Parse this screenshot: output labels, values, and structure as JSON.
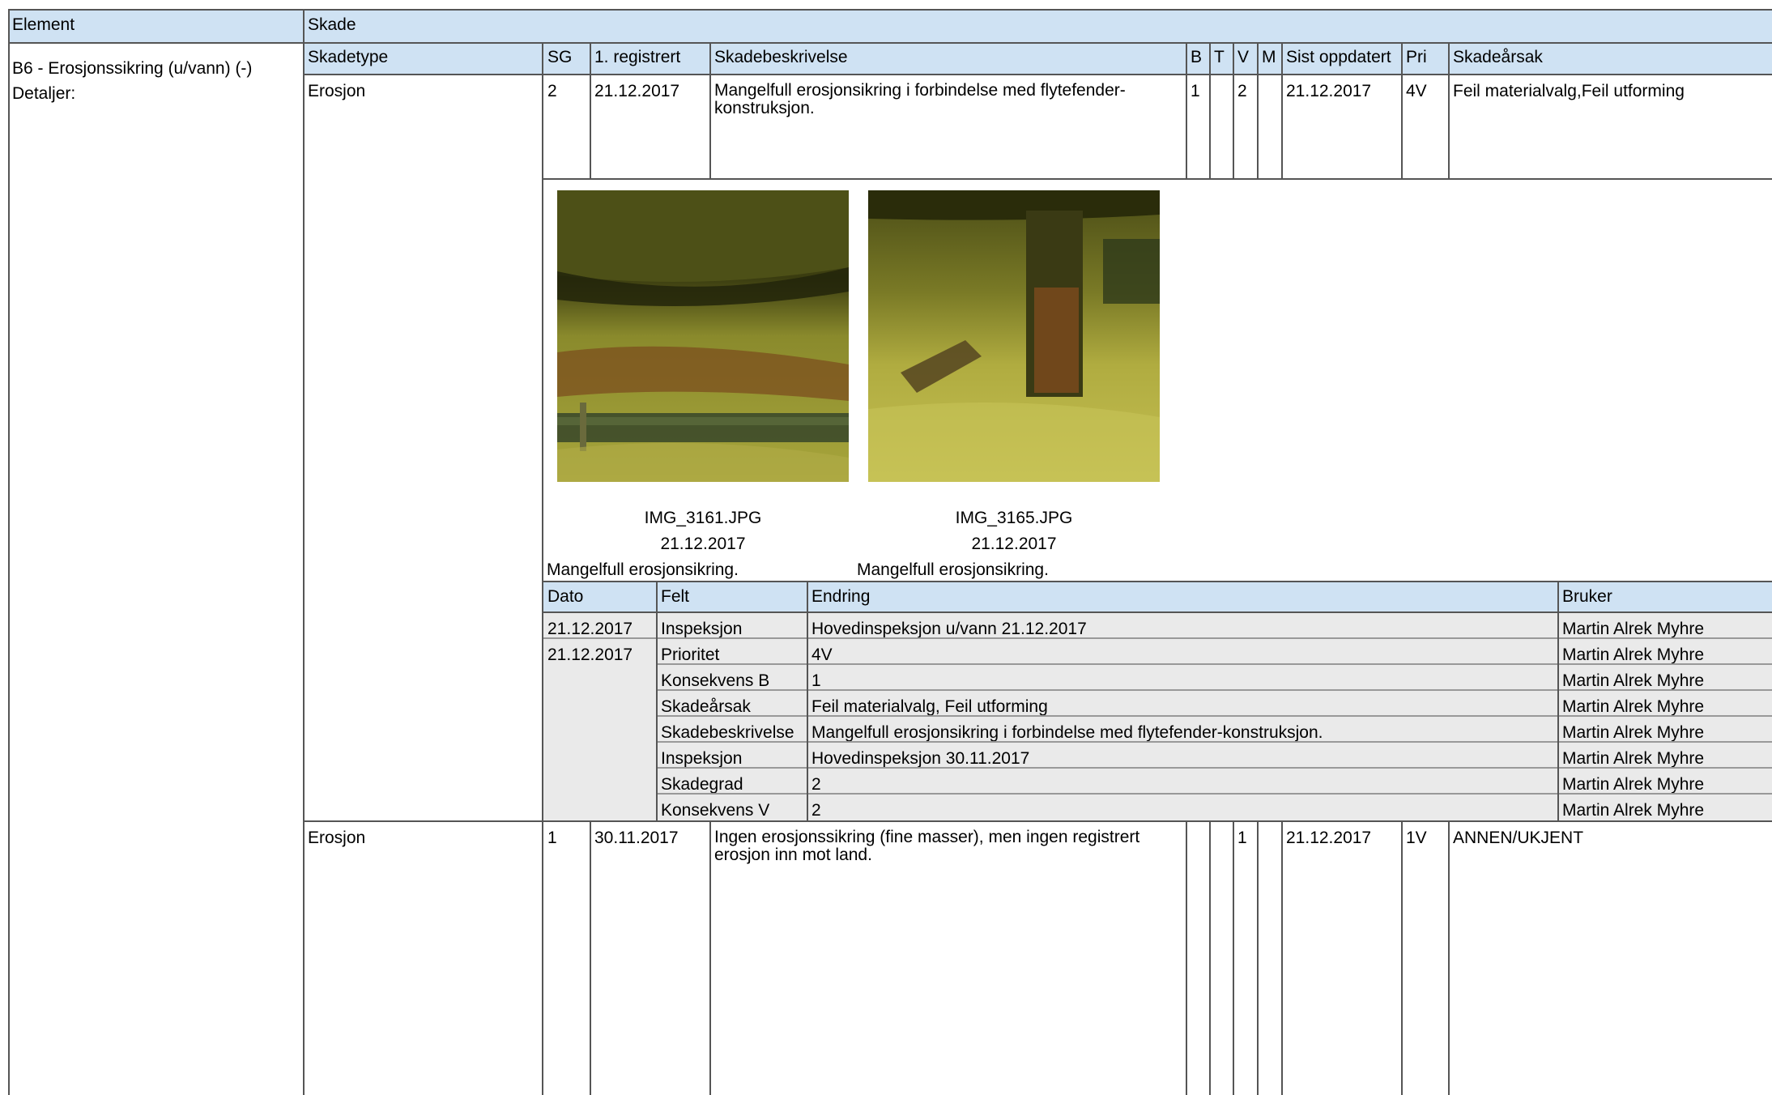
{
  "header": {
    "element": "Element",
    "skade": "Skade"
  },
  "columns": {
    "skadetype": "Skadetype",
    "sg": "SG",
    "registrert": "1. registrert",
    "beskrivelse": "Skadebeskrivelse",
    "b": "B",
    "t": "T",
    "v": "V",
    "m": "M",
    "oppdatert": "Sist oppdatert",
    "pri": "Pri",
    "arsak": "Skadeårsak"
  },
  "element": {
    "name": "B6 - Erosjonssikring (u/vann) (-)",
    "details_label": "Detaljer:"
  },
  "damages": [
    {
      "type": "Erosjon",
      "sg": "2",
      "registered": "21.12.2017",
      "description": "Mangelfull erosjonsikring i forbindelse med flytefender-konstruksjon.",
      "b": "1",
      "t": "",
      "v": "2",
      "m": "",
      "updated": "21.12.2017",
      "pri": "4V",
      "cause": "Feil materialvalg,Feil utforming"
    },
    {
      "type": "Erosjon",
      "sg": "1",
      "registered": "30.11.2017",
      "description": "Ingen erosjonssikring (fine masser), men ingen registrert erosjon inn mot land.",
      "b": "",
      "t": "",
      "v": "1",
      "m": "",
      "updated": "21.12.2017",
      "pri": "1V",
      "cause": "ANNEN/UKJENT"
    }
  ],
  "photos": [
    {
      "filename": "IMG_3161.JPG",
      "date": "21.12.2017",
      "caption": "Mangelfull erosjonsikring."
    },
    {
      "filename": "IMG_3165.JPG",
      "date": "21.12.2017",
      "caption": "Mangelfull erosjonsikring."
    }
  ],
  "history": {
    "headers": {
      "dato": "Dato",
      "felt": "Felt",
      "endring": "Endring",
      "bruker": "Bruker"
    },
    "rows": [
      {
        "date": "21.12.2017",
        "field": "Inspeksjon",
        "change": "Hovedinspeksjon u/vann 21.12.2017",
        "user": "Martin Alrek Myhre"
      },
      {
        "date": "21.12.2017",
        "field": "Prioritet",
        "change": "4V",
        "user": "Martin Alrek Myhre"
      },
      {
        "date": "",
        "field": "Konsekvens B",
        "change": "1",
        "user": "Martin Alrek Myhre"
      },
      {
        "date": "",
        "field": "Skadeårsak",
        "change": "Feil materialvalg, Feil utforming",
        "user": "Martin Alrek Myhre"
      },
      {
        "date": "",
        "field": "Skadebeskrivelse",
        "change": "Mangelfull erosjonsikring i forbindelse med flytefender-konstruksjon.",
        "user": "Martin Alrek Myhre"
      },
      {
        "date": "",
        "field": "Inspeksjon",
        "change": "Hovedinspeksjon 30.11.2017",
        "user": "Martin Alrek Myhre"
      },
      {
        "date": "",
        "field": "Skadegrad",
        "change": "2",
        "user": "Martin Alrek Myhre"
      },
      {
        "date": "",
        "field": "Konsekvens V",
        "change": "2",
        "user": "Martin Alrek Myhre"
      }
    ]
  }
}
